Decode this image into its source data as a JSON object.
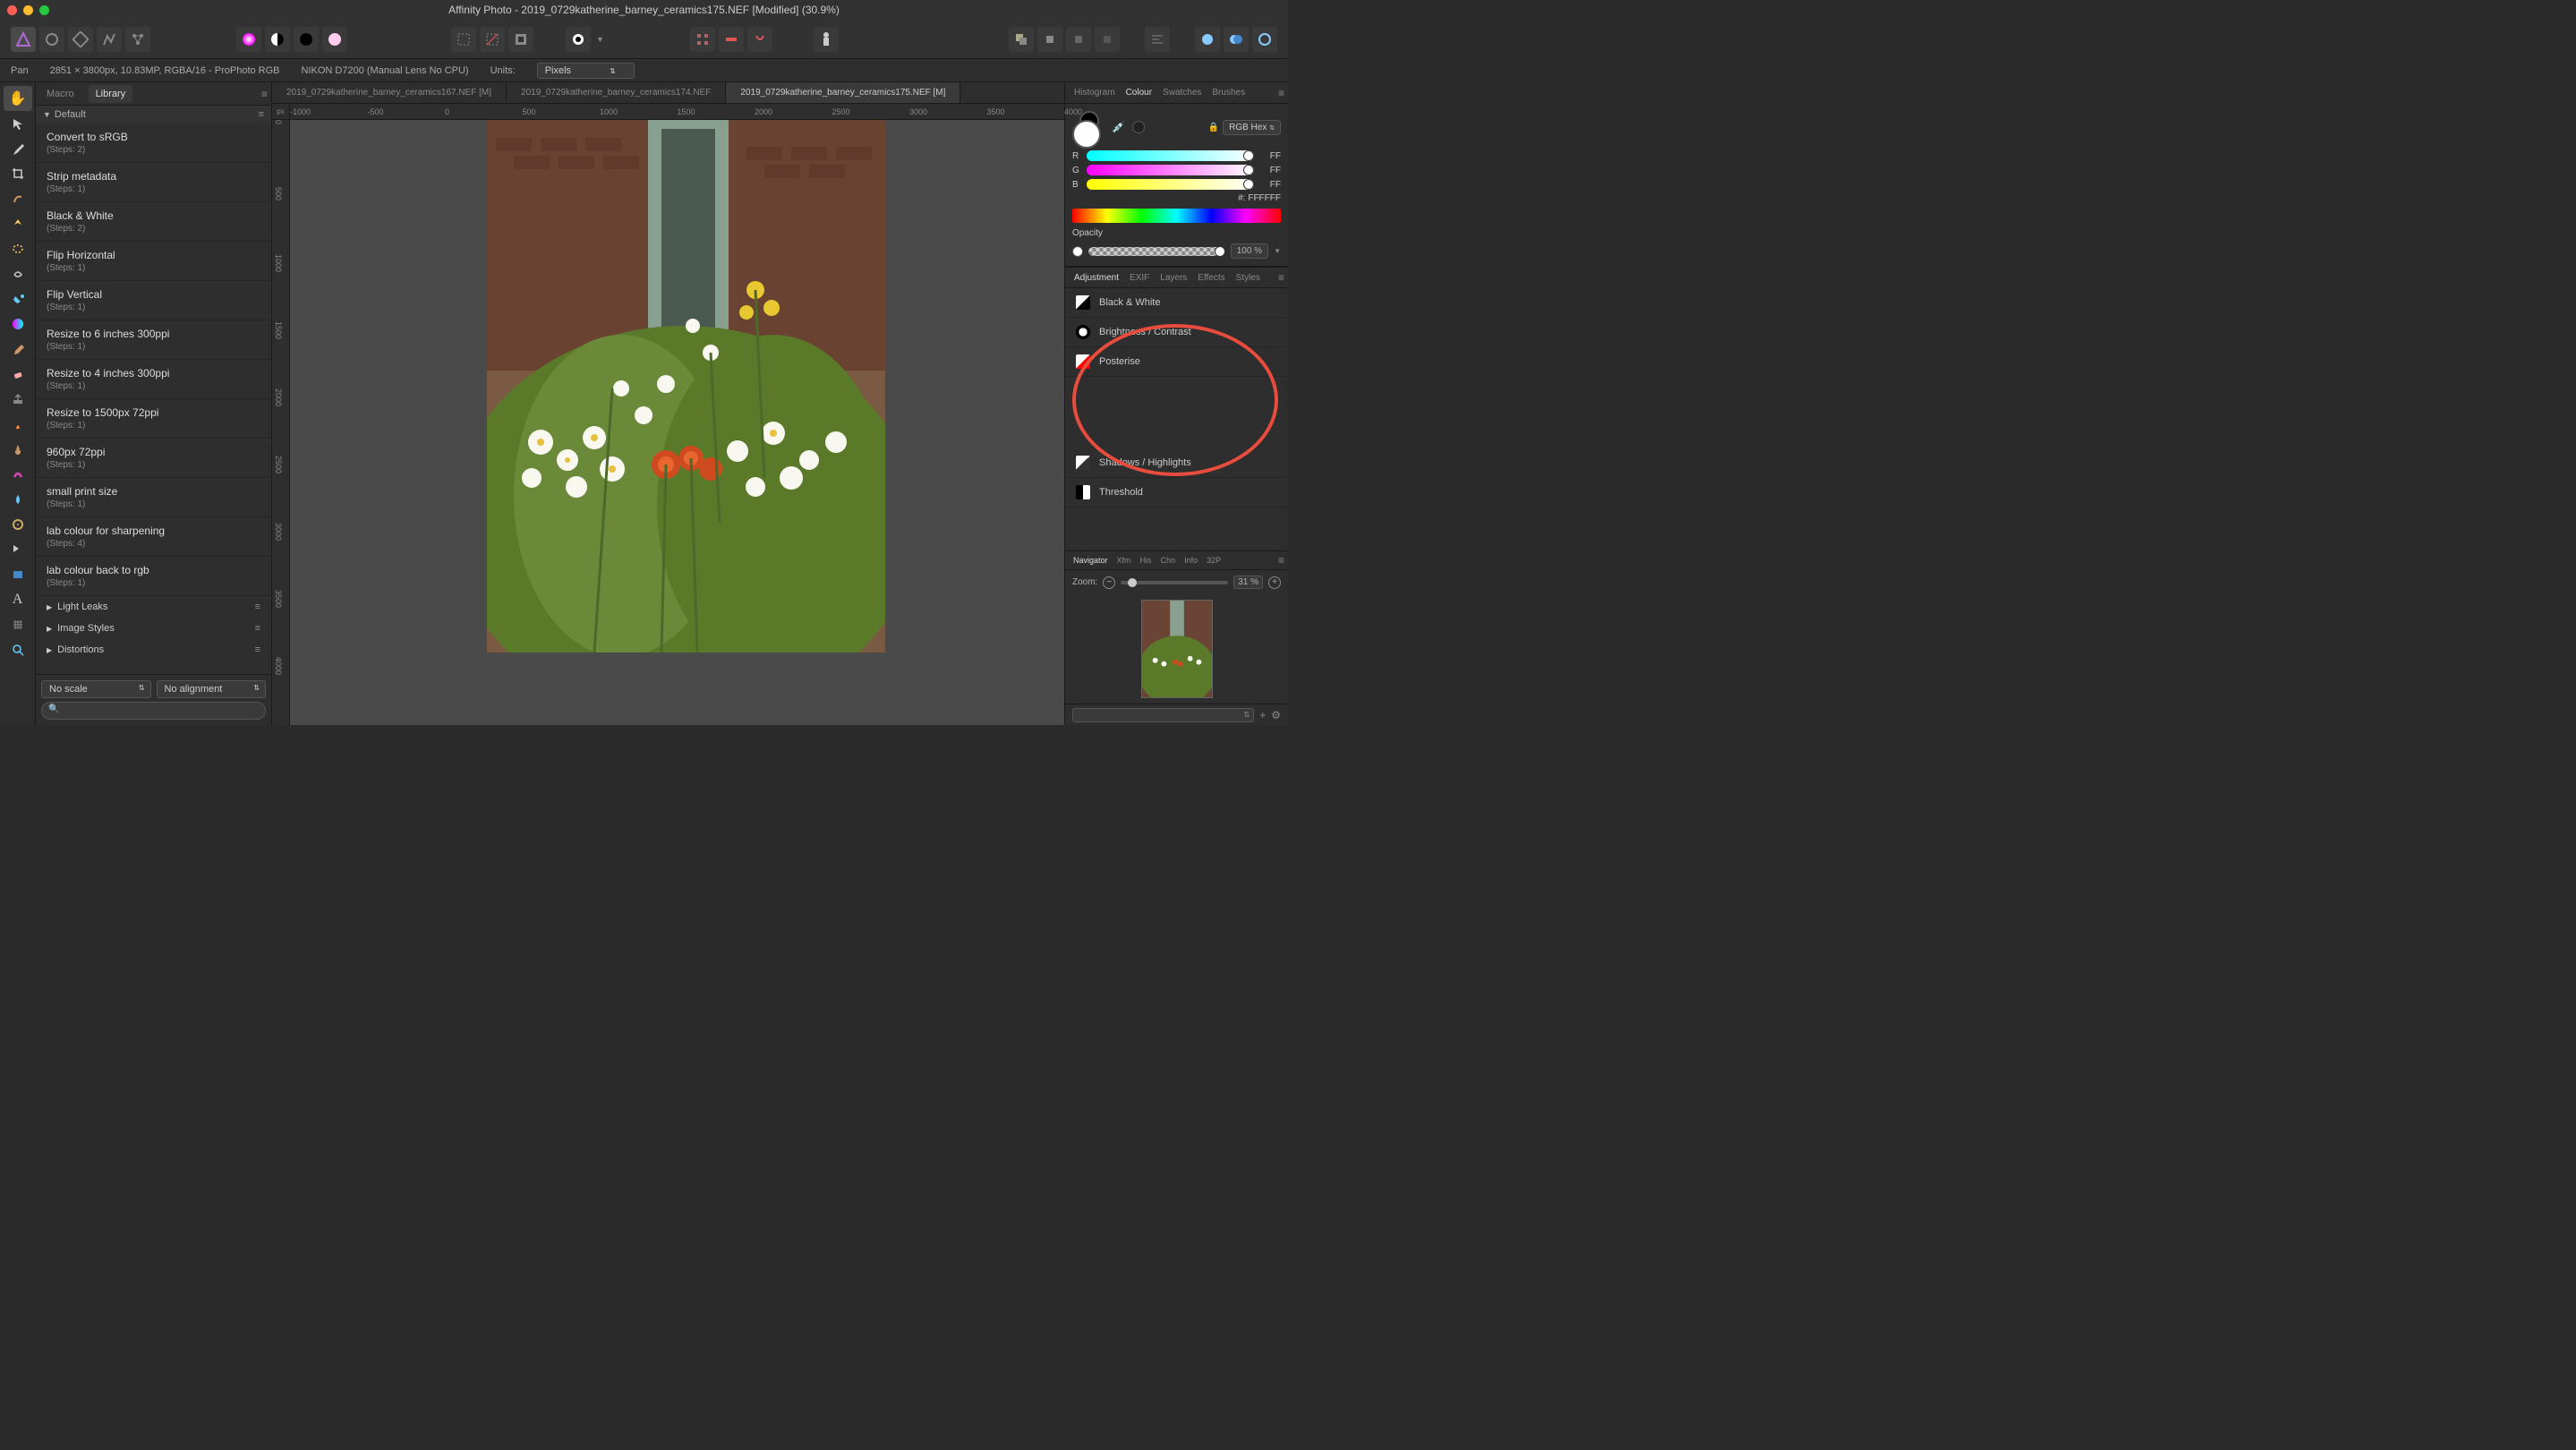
{
  "title": "Affinity Photo - 2019_0729katherine_barney_ceramics175.NEF [Modified] (30.9%)",
  "infobar": {
    "tool": "Pan",
    "dimensions": "2851 × 3800px, 10.83MP, RGBA/16 - ProPhoto RGB",
    "camera": "NIKON D7200 (Manual Lens No CPU)",
    "units_label": "Units:",
    "units_value": "Pixels"
  },
  "library": {
    "tabs": {
      "macro": "Macro",
      "library": "Library"
    },
    "header": "Default",
    "macros": [
      {
        "title": "Convert to sRGB",
        "steps": "(Steps: 2)"
      },
      {
        "title": "Strip metadata",
        "steps": "(Steps: 1)"
      },
      {
        "title": "Black & White",
        "steps": "(Steps: 2)"
      },
      {
        "title": "Flip Horizontal",
        "steps": "(Steps: 1)"
      },
      {
        "title": "Flip Vertical",
        "steps": "(Steps: 1)"
      },
      {
        "title": "Resize to 6 inches 300ppi",
        "steps": "(Steps: 1)"
      },
      {
        "title": "Resize to 4 inches 300ppi",
        "steps": "(Steps: 1)"
      },
      {
        "title": "Resize to 1500px 72ppi",
        "steps": "(Steps: 1)"
      },
      {
        "title": "960px 72ppi",
        "steps": "(Steps: 1)"
      },
      {
        "title": "small print size",
        "steps": "(Steps: 1)"
      },
      {
        "title": "lab colour for sharpening",
        "steps": "(Steps: 4)"
      },
      {
        "title": "lab colour back to rgb",
        "steps": "(Steps: 1)"
      }
    ],
    "categories": [
      "Light Leaks",
      "Image Styles",
      "Distortions"
    ],
    "footer_scale": "No scale",
    "footer_align": "No alignment"
  },
  "doc_tabs": [
    "2019_0729katherine_barney_ceramics167.NEF [M]",
    "2019_0729katherine_barney_ceramics174.NEF",
    "2019_0729katherine_barney_ceramics175.NEF [M]"
  ],
  "ruler_h": {
    "unit": "px",
    "ticks": [
      "-1000",
      "-500",
      "0",
      "500",
      "1000",
      "1500",
      "2000",
      "2500",
      "3000",
      "3500",
      "4000"
    ]
  },
  "ruler_v": [
    "0",
    "500",
    "1000",
    "1500",
    "2000",
    "2500",
    "3000",
    "3500",
    "4000"
  ],
  "colour": {
    "tabs": {
      "histogram": "Histogram",
      "colour": "Colour",
      "swatches": "Swatches",
      "brushes": "Brushes"
    },
    "mode": "RGB Hex",
    "r_label": "R",
    "r_val": "FF",
    "g_label": "G",
    "g_val": "FF",
    "b_label": "B",
    "b_val": "FF",
    "hex_label": "#:",
    "hex_val": "FFFFFF",
    "opacity_label": "Opacity",
    "opacity_val": "100 %"
  },
  "adjustment": {
    "tabs": {
      "adjustment": "Adjustment",
      "exif": "EXIF",
      "layers": "Layers",
      "effects": "Effects",
      "styles": "Styles"
    },
    "items": [
      {
        "label": "Black & White",
        "cls": "bw"
      },
      {
        "label": "Brightness / Contrast",
        "cls": "bc"
      },
      {
        "label": "Posterise",
        "cls": "pos"
      },
      {
        "label": "Shadows / Highlights",
        "cls": "sh"
      },
      {
        "label": "Threshold",
        "cls": "th"
      }
    ]
  },
  "navigator": {
    "tabs": {
      "navigator": "Navigator",
      "xfm": "Xfm",
      "his": "His",
      "chn": "Chn",
      "info": "Info",
      "t32p": "32P"
    },
    "zoom_label": "Zoom:",
    "zoom_val": "31 %"
  }
}
